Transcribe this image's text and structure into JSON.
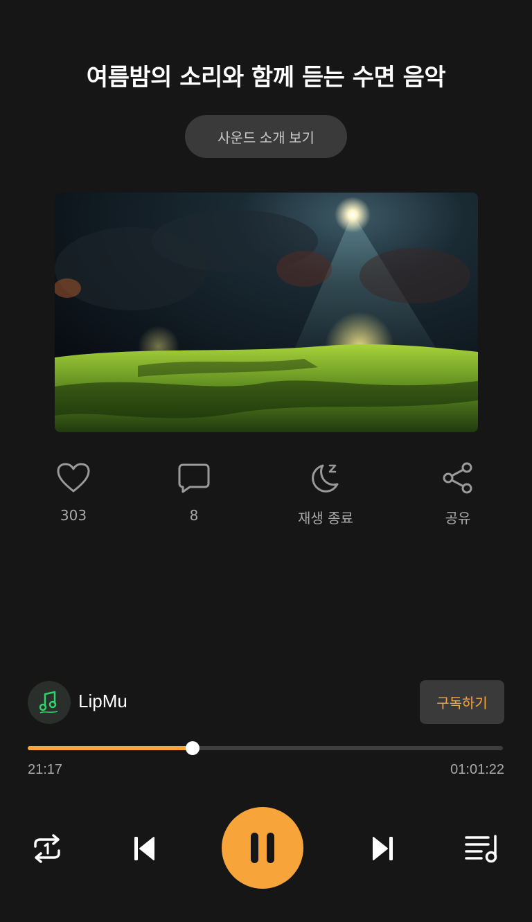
{
  "title": "여름밤의 소리와 함께 듣는 수면 음악",
  "intro_button": "사운드 소개 보기",
  "actions": [
    {
      "icon": "heart-icon",
      "label": "303"
    },
    {
      "icon": "comment-icon",
      "label": "8"
    },
    {
      "icon": "sleep-moon-icon",
      "label": "재생 종료"
    },
    {
      "icon": "share-icon",
      "label": "공유"
    }
  ],
  "channel": {
    "name": "LipMu",
    "subscribe_label": "구독하기"
  },
  "playback": {
    "elapsed": "21:17",
    "duration": "01:01:22",
    "progress_fraction": 0.347
  },
  "colors": {
    "accent": "#f7a43a",
    "background": "#161616"
  }
}
